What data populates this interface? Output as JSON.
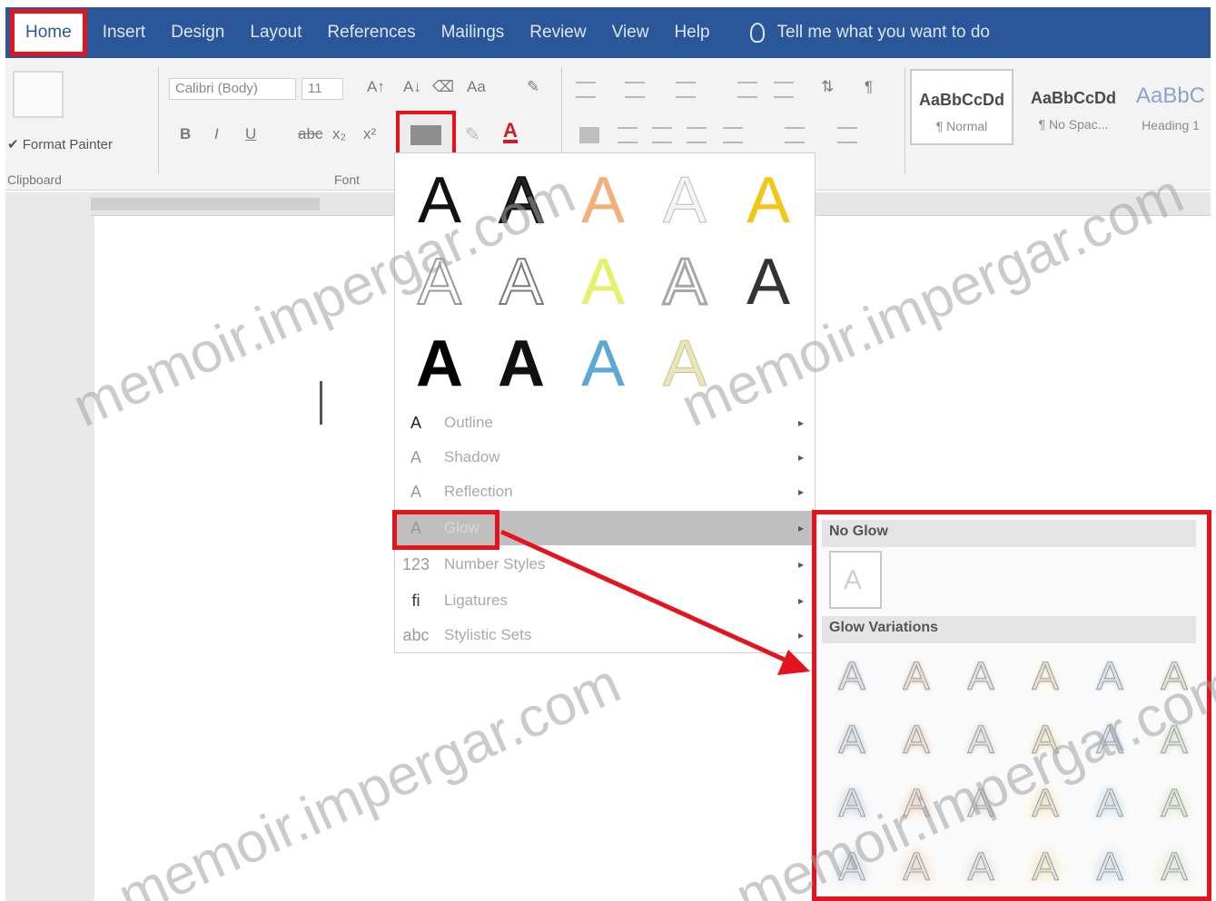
{
  "tabs": [
    "Home",
    "Insert",
    "Design",
    "Layout",
    "References",
    "Mailings",
    "Review",
    "View",
    "Help"
  ],
  "tell_me": "Tell me what you want to do",
  "ribbon": {
    "format_painter": "Format Painter",
    "clipboard_label": "Clipboard",
    "font_name": "Calibri (Body)",
    "font_size": "11",
    "font_label": "Font",
    "styles": [
      {
        "sample": "AaBbCcDd",
        "name": "¶ Normal"
      },
      {
        "sample": "AaBbCcDd",
        "name": "¶ No Spac..."
      },
      {
        "sample": "AaBbC",
        "name": "Heading 1"
      }
    ]
  },
  "effects_menu": {
    "gallery_letter": "A",
    "items": [
      {
        "icon": "outline-icon",
        "label": "Outline"
      },
      {
        "icon": "shadow-icon",
        "label": "Shadow"
      },
      {
        "icon": "reflection-icon",
        "label": "Reflection"
      },
      {
        "icon": "glow-icon",
        "label": "Glow"
      },
      {
        "icon": "number-styles-icon",
        "label": "Number Styles"
      },
      {
        "icon": "ligatures-icon",
        "label": "Ligatures"
      },
      {
        "icon": "stylistic-sets-icon",
        "label": "Stylistic Sets"
      }
    ]
  },
  "glow_panel": {
    "no_glow": "No Glow",
    "variations": "Glow Variations",
    "letter": "A"
  },
  "watermark": "memoir.impergar.com",
  "colors": {
    "tab_bar": "#2b579a",
    "highlight_red": "#e3141d"
  }
}
